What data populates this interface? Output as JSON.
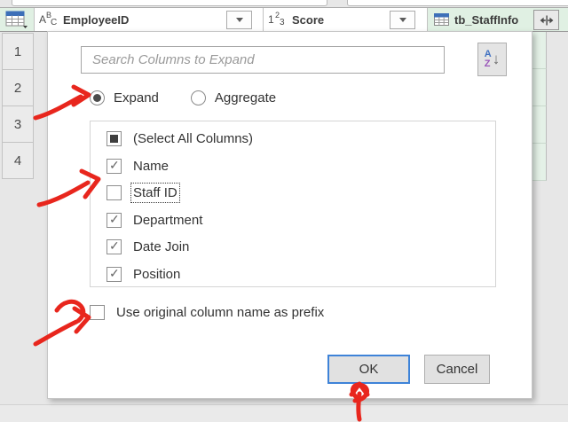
{
  "table": {
    "header": {
      "columns": [
        {
          "name": "EmployeeID",
          "type_icon": "text-abc",
          "type_icon_chars": [
            "A",
            "B",
            "C"
          ]
        },
        {
          "name": "Score",
          "type_icon": "number-123",
          "type_icon_chars": [
            "1",
            "2",
            "3"
          ]
        },
        {
          "name": "tb_StaffInfo",
          "type_icon": "table"
        }
      ]
    },
    "row_numbers": [
      "1",
      "2",
      "3",
      "4"
    ]
  },
  "dialog": {
    "search_placeholder": "Search Columns to Expand",
    "sort_letters": [
      "A",
      "Z"
    ],
    "mode_options": [
      {
        "label": "Expand",
        "selected": true
      },
      {
        "label": "Aggregate",
        "selected": false
      }
    ],
    "columns_list": [
      {
        "label": "(Select All Columns)",
        "state": "indeterminate",
        "focused": false
      },
      {
        "label": "Name",
        "state": "checked",
        "focused": false
      },
      {
        "label": "Staff ID",
        "state": "unchecked",
        "focused": true
      },
      {
        "label": "Department",
        "state": "checked",
        "focused": false
      },
      {
        "label": "Date Join",
        "state": "checked",
        "focused": false
      },
      {
        "label": "Position",
        "state": "checked",
        "focused": false
      }
    ],
    "prefix_option": {
      "label": "Use original column name as prefix",
      "checked": false
    },
    "ok_label": "OK",
    "cancel_label": "Cancel"
  },
  "annotations": {
    "arrow_color": "#e8261d",
    "arrows": [
      "expand-radio",
      "staff-id-checkbox",
      "prefix-checkbox",
      "ok-button"
    ]
  },
  "colors": {
    "selected_column_header": "#e0f0e3",
    "ok_focus_border": "#3e83d8",
    "dialog_bg": "#ffffff"
  }
}
